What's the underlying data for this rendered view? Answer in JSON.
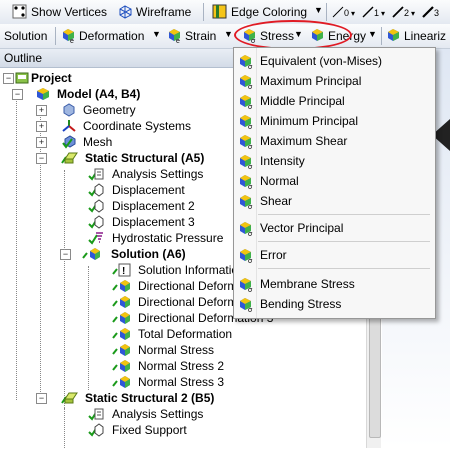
{
  "toolbar1": {
    "show_vertices": "Show Vertices",
    "wireframe": "Wireframe",
    "edge_coloring": "Edge Coloring",
    "edge_btn_0": "0",
    "edge_btn_1": "1",
    "edge_btn_2": "2",
    "edge_btn_3": "3"
  },
  "toolbar2": {
    "solution": "Solution",
    "deformation": "Deformation",
    "strain": "Strain",
    "stress": "Stress",
    "energy": "Energy",
    "linearize": "Lineariz"
  },
  "outline": {
    "header": "Outline",
    "items": [
      {
        "label": "Project"
      },
      {
        "label": "Model (A4, B4)"
      },
      {
        "label": "Geometry"
      },
      {
        "label": "Coordinate Systems"
      },
      {
        "label": "Mesh"
      },
      {
        "label": "Static Structural (A5)"
      },
      {
        "label": "Analysis Settings"
      },
      {
        "label": "Displacement"
      },
      {
        "label": "Displacement 2"
      },
      {
        "label": "Displacement 3"
      },
      {
        "label": "Hydrostatic Pressure"
      },
      {
        "label": "Solution (A6)"
      },
      {
        "label": "Solution Information"
      },
      {
        "label": "Directional Deformat"
      },
      {
        "label": "Directional Deformat"
      },
      {
        "label": "Directional Deformation 3"
      },
      {
        "label": "Total Deformation"
      },
      {
        "label": "Normal Stress"
      },
      {
        "label": "Normal Stress 2"
      },
      {
        "label": "Normal Stress 3"
      },
      {
        "label": "Static Structural 2 (B5)"
      },
      {
        "label": "Analysis Settings"
      },
      {
        "label": "Fixed Support"
      }
    ]
  },
  "stress_menu": {
    "items": [
      {
        "label": "Equivalent (von-Mises)"
      },
      {
        "label": "Maximum Principal"
      },
      {
        "label": "Middle Principal"
      },
      {
        "label": "Minimum Principal"
      },
      {
        "label": "Maximum Shear"
      },
      {
        "label": "Intensity"
      },
      {
        "label": "Normal"
      },
      {
        "label": "Shear"
      },
      {
        "label": "Vector Principal"
      },
      {
        "label": "Error"
      },
      {
        "label": "Membrane Stress"
      },
      {
        "label": "Bending Stress"
      }
    ]
  },
  "colors": {
    "highlight_ring": "#e01b24",
    "check_green": "#1a9a1a",
    "cube_blue": "#2f57d6",
    "cube_yellow": "#f2c40f",
    "cube_green": "#3fb24a"
  }
}
